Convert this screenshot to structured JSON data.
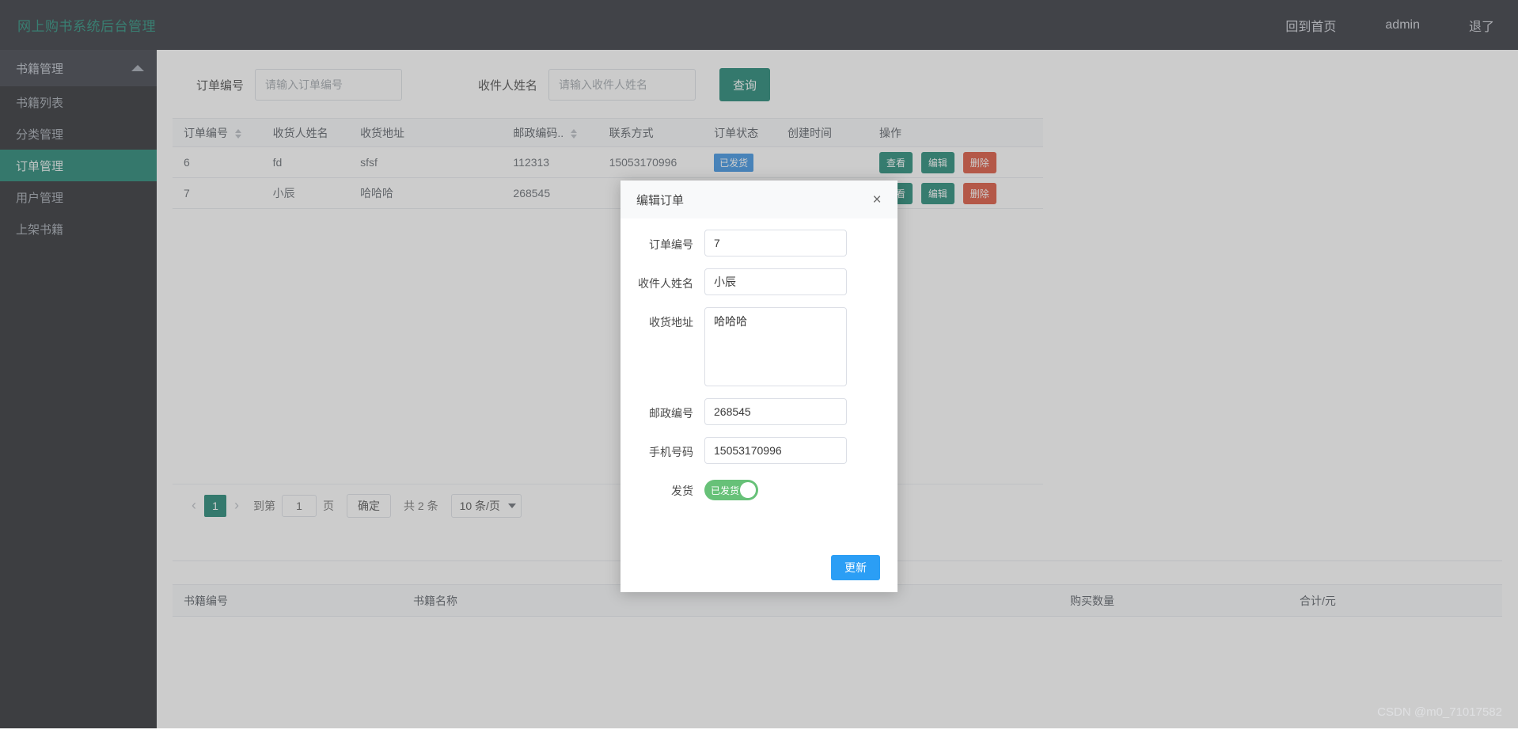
{
  "header": {
    "brand": "网上购书系统后台管理",
    "nav": [
      {
        "label": "回到首页",
        "name": "nav-home"
      },
      {
        "label": "admin",
        "name": "nav-user"
      },
      {
        "label": "退了",
        "name": "nav-logout"
      }
    ]
  },
  "sidebar": {
    "group_title": "书籍管理",
    "items": [
      {
        "label": "书籍列表",
        "active": false
      },
      {
        "label": "分类管理",
        "active": false
      },
      {
        "label": "订单管理",
        "active": true
      },
      {
        "label": "用户管理",
        "active": false
      },
      {
        "label": "上架书籍",
        "active": false
      }
    ]
  },
  "search": {
    "order_no_label": "订单编号",
    "order_no_placeholder": "请输入订单编号",
    "order_no_value": "",
    "receiver_label": "收件人姓名",
    "receiver_placeholder": "请输入收件人姓名",
    "receiver_value": "",
    "query_button": "查询"
  },
  "orders_table": {
    "columns": [
      {
        "label": "订单编号",
        "sortable": true
      },
      {
        "label": "收货人姓名",
        "sortable": false
      },
      {
        "label": "收货地址",
        "sortable": false
      },
      {
        "label": "邮政编码..",
        "sortable": true
      },
      {
        "label": "联系方式",
        "sortable": false
      },
      {
        "label": "订单状态",
        "sortable": false
      },
      {
        "label": "创建时间",
        "sortable": false
      },
      {
        "label": "操作",
        "sortable": false
      }
    ],
    "rows": [
      {
        "order_no": "6",
        "receiver": "fd",
        "address": "sfsf",
        "zip": "112313",
        "phone": "15053170996",
        "status": "已发货",
        "created": "",
        "actions": [
          "查看",
          "编辑",
          "删除"
        ]
      },
      {
        "order_no": "7",
        "receiver": "小辰",
        "address": "哈哈哈",
        "zip": "268545",
        "phone": "",
        "status": "",
        "created": "",
        "actions": [
          "查看",
          "编辑",
          "删除"
        ]
      }
    ],
    "action_labels": {
      "view": "查看",
      "edit": "编辑",
      "delete": "删除"
    }
  },
  "pagination": {
    "prev": "‹",
    "current_page": "1",
    "next": "›",
    "goto_prefix": "到第",
    "goto_value": "1",
    "goto_suffix": "页",
    "confirm": "确定",
    "total": "共 2 条",
    "page_size": "10 条/页"
  },
  "items_table": {
    "columns": [
      "书籍编号",
      "书籍名称",
      "",
      "购买数量",
      "合计/元"
    ]
  },
  "modal": {
    "title": "编辑订单",
    "close_icon": "×",
    "fields": [
      {
        "label": "订单编号",
        "value": "7",
        "type": "text"
      },
      {
        "label": "收件人姓名",
        "value": "小辰",
        "type": "text"
      },
      {
        "label": "收货地址",
        "value": "哈哈哈",
        "type": "textarea"
      },
      {
        "label": "邮政编号",
        "value": "268545",
        "type": "text"
      },
      {
        "label": "手机号码",
        "value": "15053170996",
        "type": "text"
      }
    ],
    "switch_label": "发货",
    "switch_text": "已发货",
    "switch_on": true,
    "submit": "更新"
  },
  "watermark": "CSDN @m0_71017582",
  "colors": {
    "brand_teal": "#12836e",
    "header_bg": "#20222a",
    "sidebar_bg": "#191b1f",
    "active_teal": "#0c7864",
    "query_teal": "#0b7a66",
    "badge_blue": "#2b8ae0",
    "delete_red": "#d9452a",
    "switch_green": "#67c178",
    "update_blue": "#2b9ef5"
  }
}
